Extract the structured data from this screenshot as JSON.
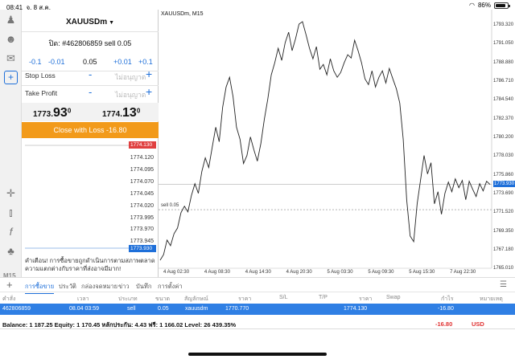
{
  "statusbar": {
    "time": "08:41",
    "date": "จ. 8 ส.ค.",
    "battery": "86%",
    "battery_level": 0.86
  },
  "toolbar": {
    "icons": [
      "account-icon",
      "user-plus-icon",
      "chat-icon",
      "new-order-icon",
      "crosshair-icon",
      "indicators-icon",
      "function-icon",
      "objects-icon"
    ],
    "timeframe": "M15"
  },
  "order": {
    "symbol": "XAUUSDm",
    "title": "ปิด: #462806859 sell 0.05",
    "vol_minus_big": "-0.1",
    "vol_minus_small": "-0.01",
    "volume": "0.05",
    "vol_plus_small": "+0.01",
    "vol_plus_big": "+0.1",
    "stop_loss_label": "Stop Loss",
    "take_profit_label": "Take Profit",
    "placeholder": "ไม่อนุญาต",
    "minus": "-",
    "plus": "+",
    "bid_main": "1773.",
    "bid_big": "93",
    "bid_sup": "0",
    "ask_main": "1774.",
    "ask_big": "13",
    "ask_sup": "0",
    "close_button": "Close with Loss -16.80",
    "warning": "คำเตือน! การซื้อขายถูกดำเนินการตามสภาพตลาด ความแตกต่างกับราคาที่ส่งอาจมีมาก!"
  },
  "mini_chart": {
    "ticks": [
      "1774.120",
      "1774.095",
      "1774.070",
      "1774.045",
      "1774.020",
      "1773.995",
      "1773.970",
      "1773.945"
    ],
    "ask_label": "1774.130",
    "bid_label": "1773.930",
    "ask_color": "#e04040",
    "bid_color": "#1e6fd9"
  },
  "chart_data": {
    "type": "line",
    "title": "XAUUSDm, M15",
    "yticks": [
      "1793.320",
      "1791.050",
      "1788.880",
      "1786.710",
      "1784.540",
      "1782.370",
      "1780.200",
      "1778.030",
      "1775.860",
      "1773.690",
      "1771.520",
      "1769.350",
      "1767.180",
      "1765.010"
    ],
    "xticks": [
      "4 Aug 02:30",
      "4 Aug 08:30",
      "4 Aug 14:30",
      "4 Aug 20:30",
      "5 Aug 03:30",
      "5 Aug 09:30",
      "5 Aug 15:30",
      "7 Aug 22:30"
    ],
    "ylim": [
      1763.9,
      1794.6
    ],
    "values": [
      1764.5,
      1765.2,
      1767.0,
      1766.3,
      1767.8,
      1768.5,
      1770.4,
      1771.2,
      1770.5,
      1772.5,
      1774.0,
      1772.8,
      1775.5,
      1777.2,
      1776.0,
      1778.5,
      1781.0,
      1779.2,
      1783.5,
      1786.0,
      1787.2,
      1784.8,
      1781.0,
      1779.5,
      1776.5,
      1777.5,
      1779.8,
      1778.2,
      1776.8,
      1779.0,
      1782.0,
      1784.5,
      1787.5,
      1789.0,
      1790.8,
      1789.3,
      1791.5,
      1792.8,
      1790.5,
      1792.0,
      1793.8,
      1794.1,
      1792.5,
      1790.8,
      1789.5,
      1791.0,
      1788.2,
      1788.8,
      1787.5,
      1789.5,
      1788.0,
      1787.2,
      1787.8,
      1789.0,
      1790.0,
      1789.6,
      1791.8,
      1790.5,
      1789.0,
      1787.0,
      1786.3,
      1788.0,
      1786.0,
      1787.2,
      1788.0,
      1786.5,
      1788.3,
      1787.0,
      1785.8,
      1784.0,
      1779.5,
      1772.0,
      1767.5,
      1766.8,
      1771.5,
      1774.5,
      1777.5,
      1775.2,
      1776.6,
      1771.5,
      1773.0,
      1770.2,
      1772.8,
      1774.2,
      1773.0,
      1774.6,
      1773.5,
      1774.4,
      1772.0,
      1774.3,
      1773.3,
      1772.4,
      1774.0,
      1773.1,
      1774.3,
      1773.9
    ],
    "current_price": "1773.930",
    "position_label": "sell 0.05",
    "position_price": 1770.77,
    "price_line": 1773.93,
    "line_color": "#222222",
    "grid": false
  },
  "terminal": {
    "tabs": [
      "การซื้อขาย",
      "ประวัติ",
      "กล่องจดหมาย",
      "ข่าว",
      "บันทึก",
      "การตั้งค่า"
    ],
    "columns": [
      "คำสั่ง",
      "เวลา",
      "ประเภท",
      "ขนาด",
      "สัญลักษณ์",
      "ราคา",
      "S/L",
      "T/P",
      "ราคา",
      "Swap",
      "กำไร",
      "หมายเหตุ"
    ],
    "row": [
      "462806859",
      "08.04 03:59",
      "sell",
      "0.05",
      "xauusdm",
      "1770.770",
      "",
      "",
      "1774.130",
      "",
      "-16.80",
      ""
    ],
    "balance": "Balance: 1 187.25 Equity: 1 170.45 หลักประกัน: 4.43 ฟรี: 1 166.02 Level: 26 439.35%",
    "balance_profit": "-16.80",
    "currency": "USD"
  }
}
